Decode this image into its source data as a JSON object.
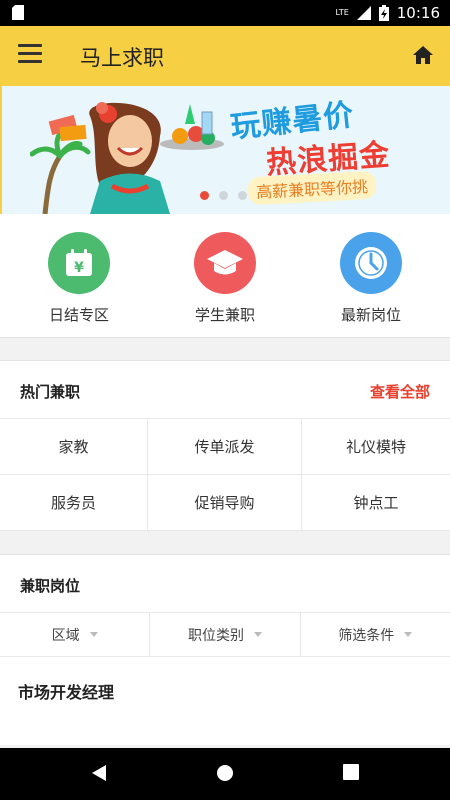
{
  "status_bar": {
    "time": "10:16",
    "network": "LTE",
    "icons": [
      "sd-card-icon",
      "signal-icon",
      "battery-charging-icon"
    ]
  },
  "app_bar": {
    "title": "马上求职",
    "menu_icon": "menu-icon",
    "home_icon": "home-icon"
  },
  "banner": {
    "headline": "玩赚暑价",
    "subheadline": "热浪掘金",
    "tagline": "高薪兼职等你挑",
    "dots": 3,
    "active_dot": 0
  },
  "categories": [
    {
      "label": "日结专区",
      "icon": "calendar-yen-icon",
      "color": "#4cbb6f"
    },
    {
      "label": "学生兼职",
      "icon": "graduation-cap-icon",
      "color": "#ef5a5d"
    },
    {
      "label": "最新岗位",
      "icon": "clock-icon",
      "color": "#4aa3ea"
    }
  ],
  "hot_jobs": {
    "title": "热门兼职",
    "view_all": "查看全部",
    "items": [
      "家教",
      "传单派发",
      "礼仪模特",
      "服务员",
      "促销导购",
      "钟点工"
    ]
  },
  "job_positions": {
    "title": "兼职岗位",
    "filters": [
      "区域",
      "职位类别",
      "筛选条件"
    ],
    "jobs": [
      {
        "title": "市场开发经理"
      }
    ]
  },
  "colors": {
    "accent": "#f7cf43",
    "link": "#e8412f"
  }
}
